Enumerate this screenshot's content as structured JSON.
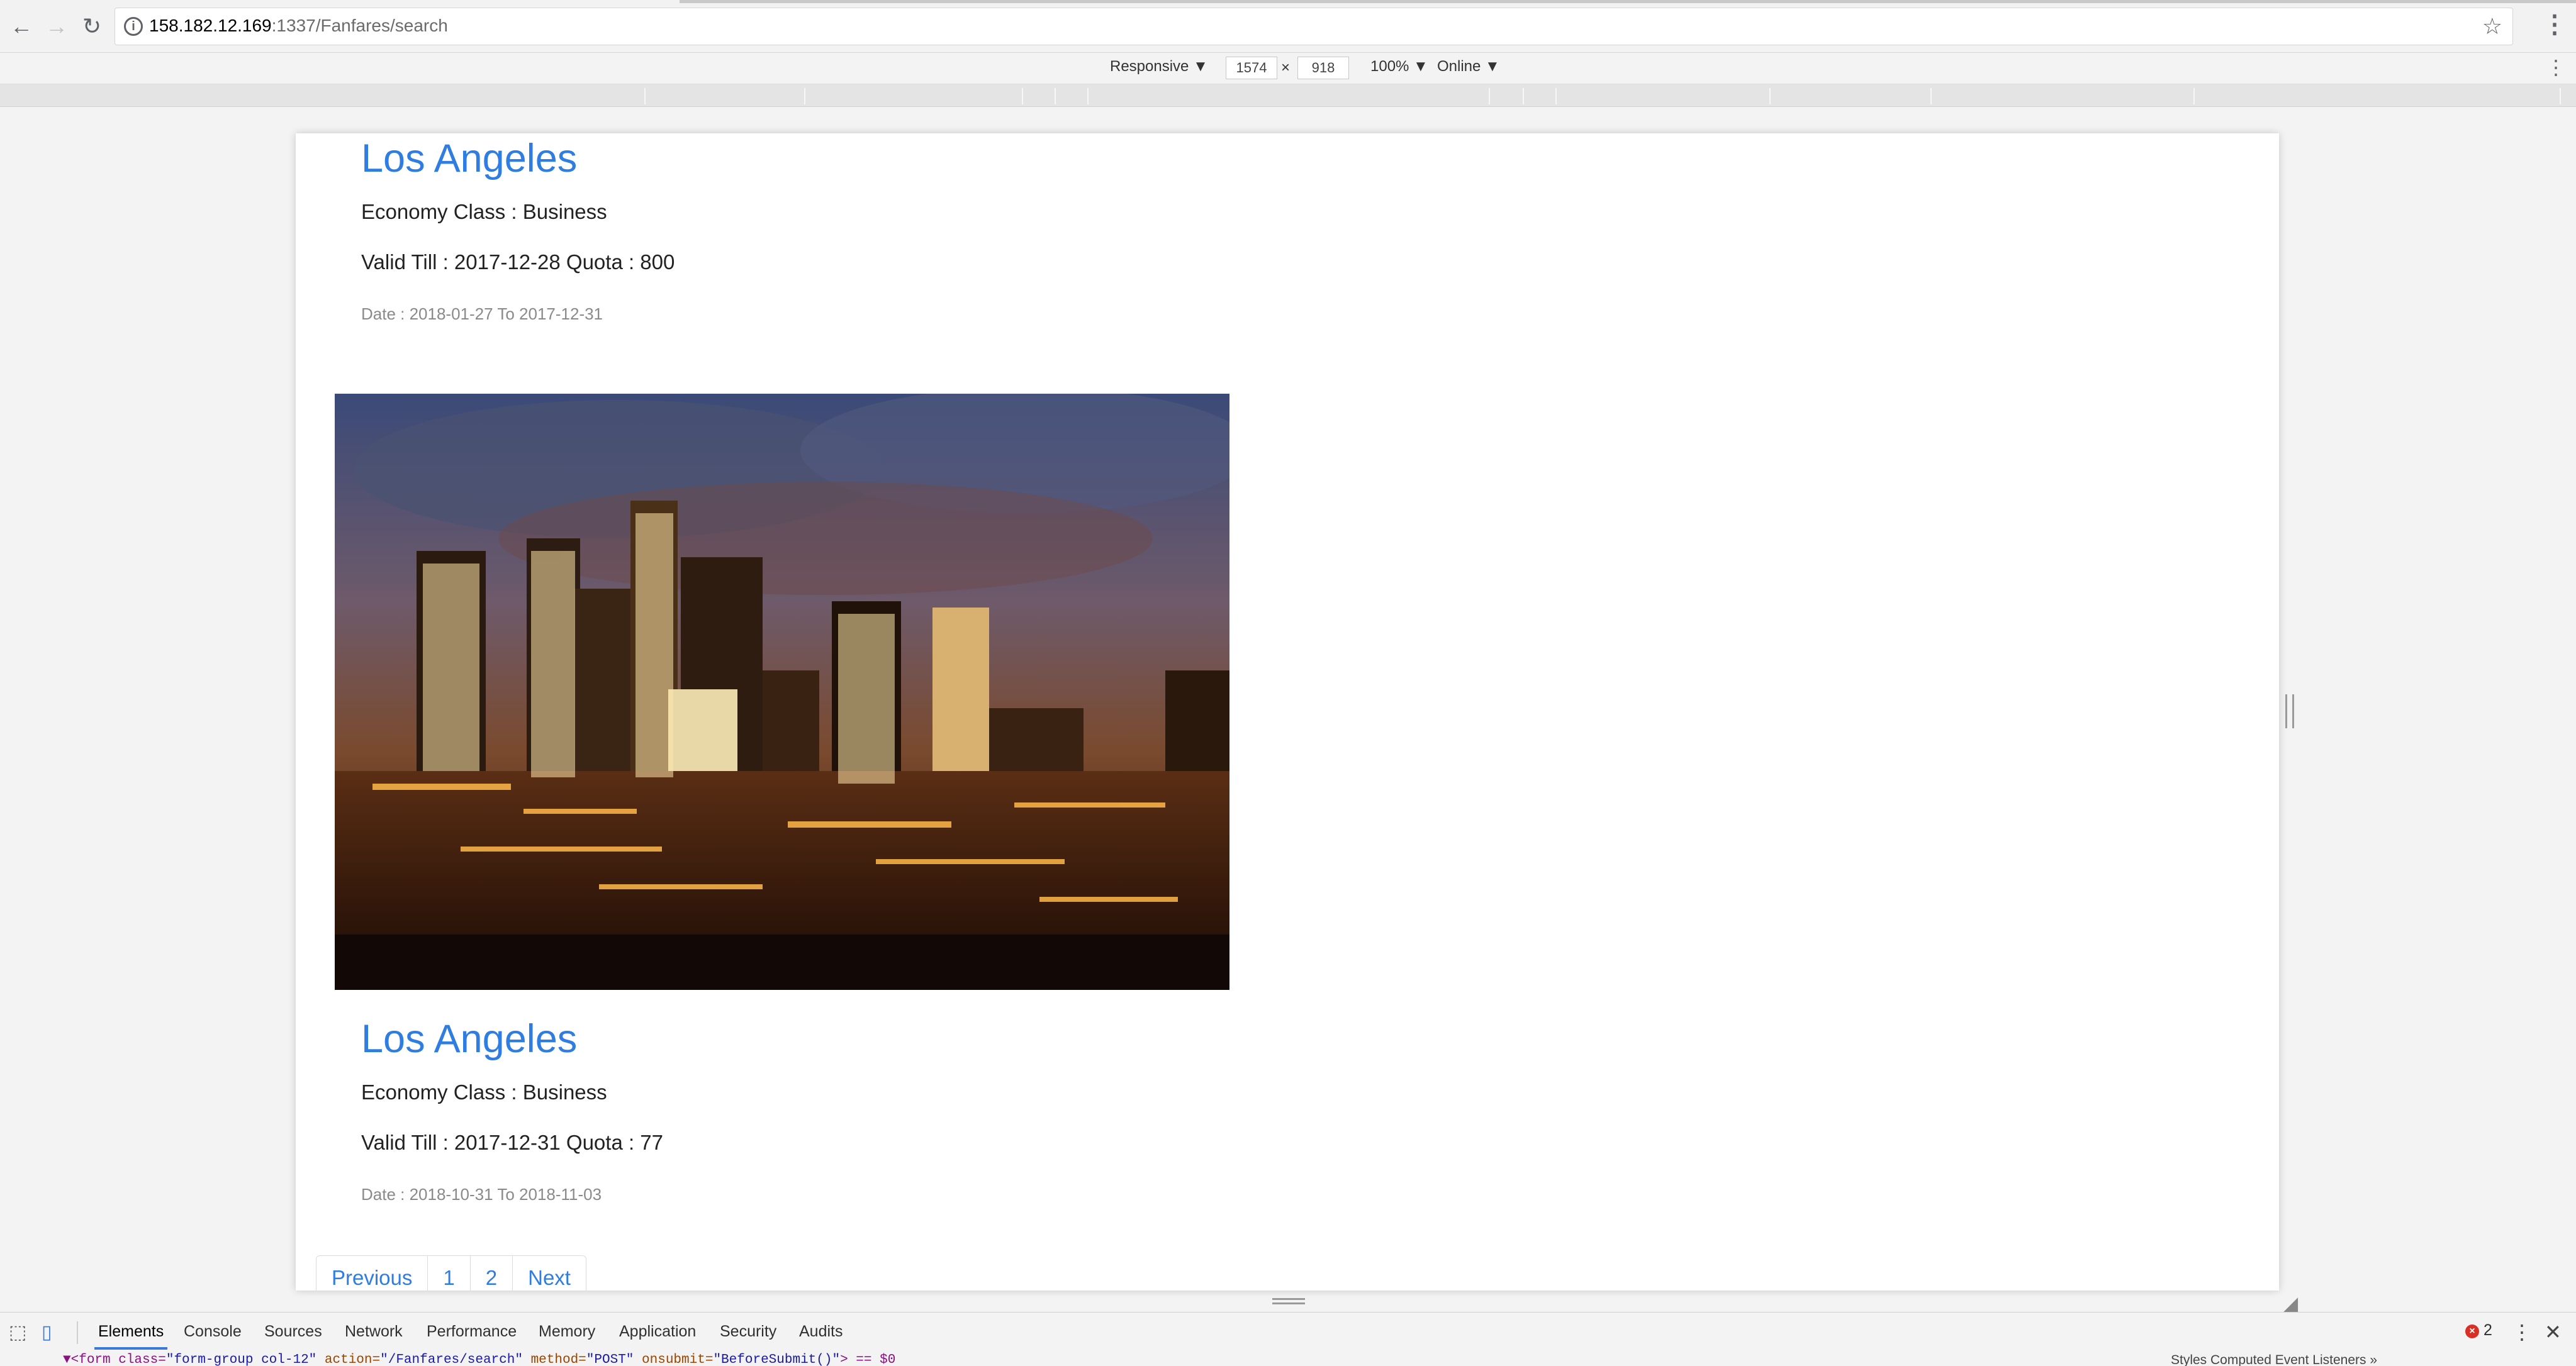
{
  "browser": {
    "url_host": "158.182.12.169",
    "url_path": ":1337/Fanfares/search"
  },
  "device_toolbar": {
    "device": "Responsive ▼",
    "width": "1574",
    "x": "×",
    "height": "918",
    "zoom": "100% ▼",
    "network": "Online ▼"
  },
  "results": [
    {
      "city": "Los Angeles",
      "economy_class": "Economy Class : Business",
      "valid_quota": "Valid Till : 2017-12-28  Quota :  800",
      "date": "Date : 2018-01-27 To 2017-12-31"
    },
    {
      "city": "Los Angeles",
      "economy_class": "Economy Class : Business",
      "valid_quota": "Valid Till : 2017-12-31  Quota :  77",
      "date": "Date : 2018-10-31 To 2018-11-03"
    }
  ],
  "pagination": {
    "previous": "Previous",
    "page1": "1",
    "page2": "2",
    "next": "Next"
  },
  "devtools": {
    "tabs": [
      "Elements",
      "Console",
      "Sources",
      "Network",
      "Performance",
      "Memory",
      "Application",
      "Security",
      "Audits"
    ],
    "error_count": "2",
    "code_tag": "<form class=",
    "code_class": "\"form-group col-12\"",
    "code_action_attr": " action=",
    "code_action": "\"/Fanfares/search\"",
    "code_method_attr": " method=",
    "code_method": "\"POST\"",
    "code_onsubmit_attr": " onsubmit=",
    "code_onsubmit": "\"BeforeSubmit()\"",
    "code_tail": "> == $0",
    "side_tabs": "Styles   Computed   Event Listeners   »"
  }
}
